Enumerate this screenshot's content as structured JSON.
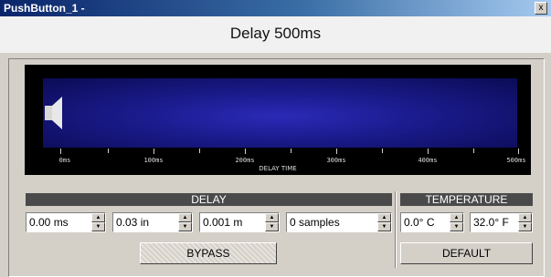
{
  "window": {
    "title": "PushButton_1 -",
    "close_glyph": "x"
  },
  "header": {
    "title": "Delay 500ms"
  },
  "display": {
    "speaker_icon": "speaker-icon",
    "axis": {
      "title": "DELAY TIME",
      "labels": [
        "0ms",
        "100ms",
        "200ms",
        "300ms",
        "400ms",
        "500ms"
      ]
    }
  },
  "delay": {
    "section_label": "DELAY",
    "fields": [
      {
        "value": "0.00 ms"
      },
      {
        "value": "0.03 in"
      },
      {
        "value": "0.001 m"
      },
      {
        "value": "0 samples"
      }
    ],
    "bypass_label": "BYPASS"
  },
  "temperature": {
    "section_label": "TEMPERATURE",
    "fields": [
      {
        "value": "0.0° C"
      },
      {
        "value": "32.0° F"
      }
    ],
    "default_label": "DEFAULT"
  },
  "colors": {
    "title_bar": "#0a246a",
    "display_bg": "#1a1a8a",
    "section_bar": "#4a4a4a"
  }
}
